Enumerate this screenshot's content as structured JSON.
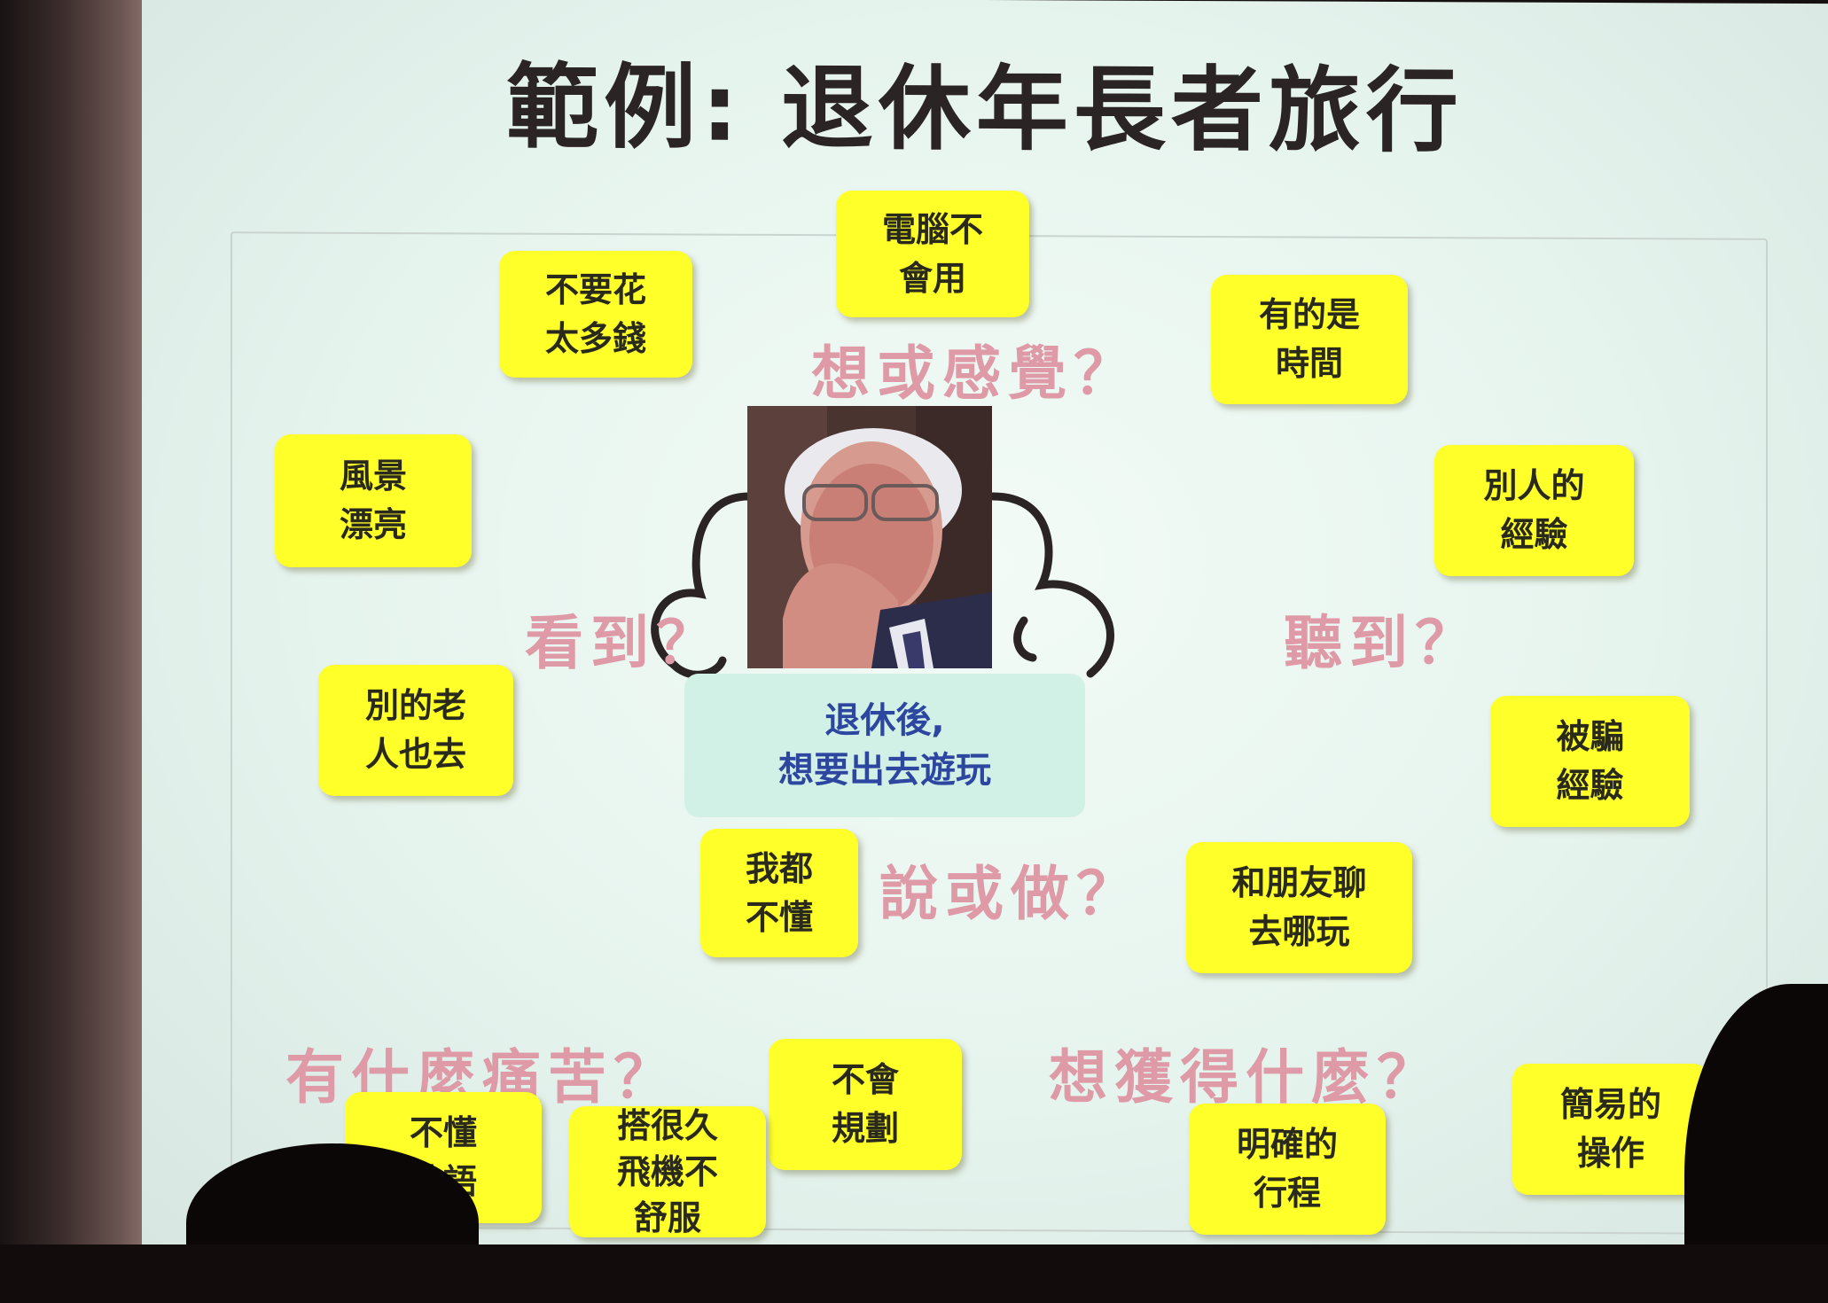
{
  "slide": {
    "title": "範例: 退休年長者旅行",
    "center_text": "退休後,\n想要出去遊玩",
    "questions": {
      "think_feel": "想或感覺？",
      "see": "看到？",
      "hear": "聽到？",
      "say_do": "說或做？",
      "pain": "有什麼痛苦？",
      "gain": "想獲得什麼？"
    },
    "notes": {
      "computer": "電腦不\n會用",
      "money": "不要花\n太多錢",
      "time": "有的是\n時間",
      "scenery": "風景\n漂亮",
      "others_exp": "別人的\n經驗",
      "other_elders": "別的老\n人也去",
      "scammed": "被騙\n經驗",
      "dont_understand": "我都\n不懂",
      "chat_friends": "和朋友聊\n去哪玩",
      "planning": "不會\n規劃",
      "language": "不懂\n外語",
      "long_flight": "搭很久\n飛機不\n舒服",
      "itinerary": "明確的\n行程",
      "easy_operation": "簡易的\n操作"
    }
  },
  "colors": {
    "note_bg": "#ffff29",
    "question_text": "#de9aa6",
    "center_text": "#2d46a0",
    "center_bg": "#d2f1e6",
    "title_text": "#2b2424"
  }
}
